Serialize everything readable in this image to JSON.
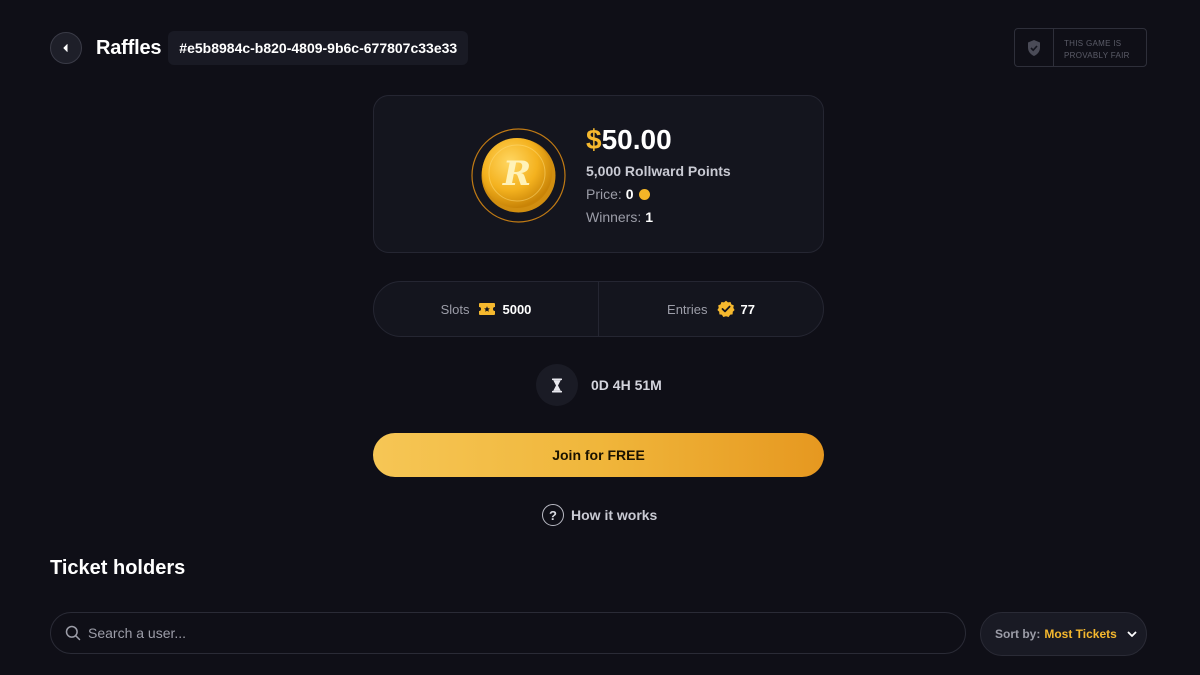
{
  "header": {
    "title": "Raffles",
    "raffle_id": "#e5b8984c-b820-4809-9b6c-677807c33e33",
    "fair_badge_line1": "THIS GAME IS",
    "fair_badge_line2": "PROVABLY FAIR"
  },
  "prize": {
    "currency_symbol": "$",
    "amount": "50.00",
    "description": "5,000 Rollward Points",
    "price_label": "Price:",
    "price_value": "0",
    "winners_label": "Winners:",
    "winners_value": "1",
    "coin_letter": "R"
  },
  "stats": {
    "slots_label": "Slots",
    "slots_value": "5000",
    "entries_label": "Entries",
    "entries_value": "77"
  },
  "timer": {
    "remaining": "0D 4H 51M"
  },
  "actions": {
    "join_label": "Join for FREE",
    "how_it_works_label": "How it works"
  },
  "ticket_holders": {
    "title": "Ticket holders",
    "search_placeholder": "Search a user...",
    "sort_label": "Sort by:",
    "sort_value": "Most Tickets"
  },
  "colors": {
    "background": "#0f0f17",
    "accent_gold": "#f5b82e",
    "card": "#14151e",
    "border": "#252632"
  },
  "icons": [
    "back-arrow-icon",
    "shield-icon",
    "coin-icon",
    "ticket-icon",
    "verified-badge-icon",
    "hourglass-icon",
    "question-icon",
    "search-icon",
    "chevron-down-icon"
  ]
}
